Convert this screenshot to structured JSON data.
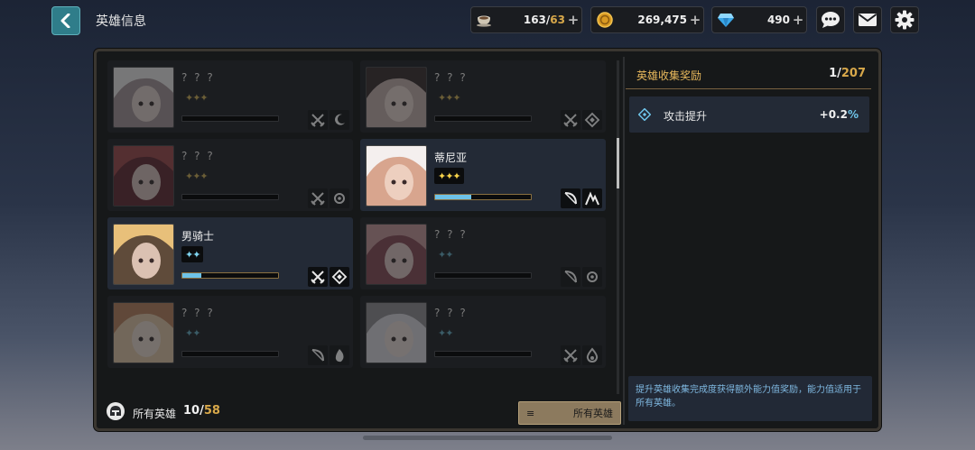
{
  "header": {
    "title": "英雄信息",
    "stamina": {
      "current": "163",
      "max": "63"
    },
    "gold": "269,475",
    "gems": "490"
  },
  "heroes": [
    {
      "name": "? ? ?",
      "stars": "✦✦✦",
      "star_type": "gold",
      "owned": false,
      "progress": 0,
      "badge1": "crossed-swords-icon",
      "badge2": "moon-icon"
    },
    {
      "name": "? ? ?",
      "stars": "✦✦✦",
      "star_type": "gold",
      "owned": false,
      "progress": 0,
      "badge1": "crossed-swords-icon",
      "badge2": "diamond-icon"
    },
    {
      "name": "? ? ?",
      "stars": "✦✦✦",
      "star_type": "gold",
      "owned": false,
      "progress": 0,
      "badge1": "crossed-swords-icon",
      "badge2": "gear-icon"
    },
    {
      "name": "蒂尼亚",
      "stars": "✦✦✦",
      "star_type": "gold",
      "owned": true,
      "progress": 0.38,
      "badge1": "bow-icon",
      "badge2": "mountain-icon"
    },
    {
      "name": "男骑士",
      "stars": "✦✦",
      "star_type": "blue",
      "owned": true,
      "progress": 0.2,
      "badge1": "crossed-swords-icon",
      "badge2": "diamond-icon"
    },
    {
      "name": "? ? ?",
      "stars": "✦✦",
      "star_type": "blue",
      "owned": false,
      "progress": 0,
      "badge1": "bow-icon",
      "badge2": "gear-icon"
    },
    {
      "name": "? ? ?",
      "stars": "✦✦",
      "star_type": "blue",
      "owned": false,
      "progress": 0,
      "badge1": "bow-icon",
      "badge2": "flame-icon"
    },
    {
      "name": "? ? ?",
      "stars": "✦✦",
      "star_type": "blue",
      "owned": false,
      "progress": 0,
      "badge1": "crossed-swords-icon",
      "badge2": "drop-icon"
    }
  ],
  "footer": {
    "label": "所有英雄",
    "owned": "10",
    "total": "58",
    "filter_label": "所有英雄"
  },
  "side": {
    "title": "英雄收集奖励",
    "level": "1",
    "max_level": "207",
    "bonus_label": "攻击提升",
    "bonus_value": "+0.2",
    "bonus_unit": "%",
    "note": "提升英雄收集完成度获得额外能力值奖励，能力值适用于所有英雄。"
  },
  "colors": {
    "accent_gold": "#d8a84a",
    "accent_blue": "#6ec3e8",
    "panel_bg": "#161819"
  }
}
